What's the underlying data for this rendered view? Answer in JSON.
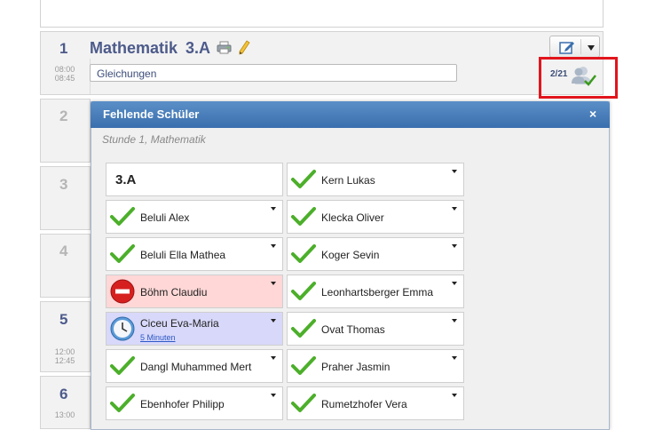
{
  "lesson": {
    "number": "1",
    "subject": "Mathematik",
    "class": "3.A",
    "start": "08:00",
    "end": "08:45",
    "topic": "Gleichungen",
    "attendance_count": "2/21"
  },
  "side_lessons": [
    {
      "number": "2",
      "start": "",
      "end": ""
    },
    {
      "number": "3",
      "start": "",
      "end": ""
    },
    {
      "number": "4",
      "start": "",
      "end": ""
    },
    {
      "number": "5",
      "start": "12:00",
      "end": "12:45"
    },
    {
      "number": "6",
      "start": "13:00",
      "end": ""
    }
  ],
  "modal": {
    "title": "Fehlende Schüler",
    "close": "×",
    "subtitle": "Stunde 1, Mathematik"
  },
  "students": {
    "class_label": "3.A",
    "left": [
      {
        "name": "Beluli Alex",
        "status": "present"
      },
      {
        "name": "Beluli Ella Mathea",
        "status": "present"
      },
      {
        "name": "Böhm Claudiu",
        "status": "absent"
      },
      {
        "name": "Ciceu Eva-Maria",
        "status": "late",
        "late_note": "5 Minuten"
      },
      {
        "name": "Dangl Muhammed Mert",
        "status": "present"
      },
      {
        "name": "Ebenhofer Philipp",
        "status": "present"
      }
    ],
    "right": [
      {
        "name": "Kern Lukas",
        "status": "present"
      },
      {
        "name": "Klecka Oliver",
        "status": "present"
      },
      {
        "name": "Koger Sevin",
        "status": "present"
      },
      {
        "name": "Leonhartsberger Emma",
        "status": "present"
      },
      {
        "name": "Ovat Thomas",
        "status": "present"
      },
      {
        "name": "Praher Jasmin",
        "status": "present"
      },
      {
        "name": "Rumetzhofer Vera",
        "status": "present"
      }
    ]
  },
  "colors": {
    "accent": "#4d5b8b",
    "modal_header": "#3a6fae",
    "absent_bg": "#ffd7d7",
    "late_bg": "#d8d8fa",
    "highlight": "#e2151c",
    "check": "#4caf2a"
  }
}
